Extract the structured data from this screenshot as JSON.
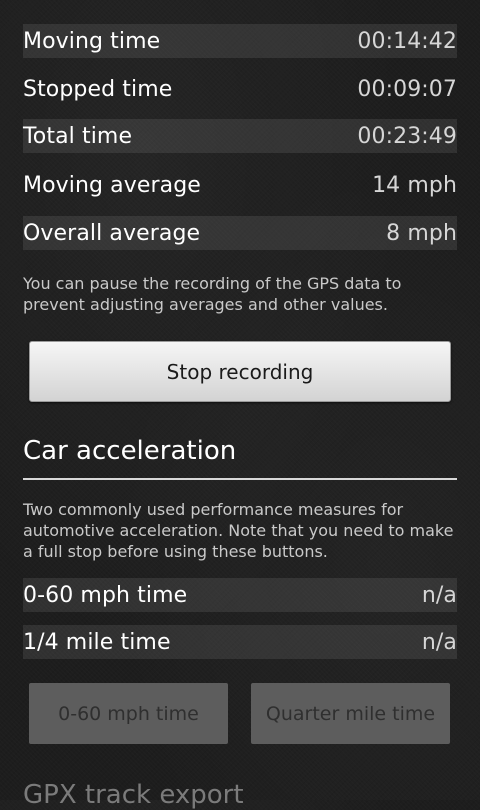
{
  "stats": [
    {
      "label": "Moving time",
      "value": "00:14:42"
    },
    {
      "label": "Stopped time",
      "value": "00:09:07"
    },
    {
      "label": "Total time",
      "value": "00:23:49"
    },
    {
      "label": "Moving average",
      "value": "14 mph"
    },
    {
      "label": "Overall average",
      "value": "8 mph"
    }
  ],
  "recording": {
    "hint": "You can pause the recording of the GPS data to prevent adjusting averages and other values.",
    "button_label": "Stop recording"
  },
  "car_acceleration": {
    "title": "Car acceleration",
    "hint": "Two commonly used performance measures for automotive acceleration. Note that you need to make a full stop before using these buttons.",
    "rows": [
      {
        "label": "0-60 mph time",
        "value": "n/a"
      },
      {
        "label": "1/4 mile time",
        "value": "n/a"
      }
    ],
    "buttons": [
      {
        "label": "0-60 mph time"
      },
      {
        "label": "Quarter mile time"
      }
    ]
  },
  "next_section": {
    "title": "GPX track export"
  }
}
